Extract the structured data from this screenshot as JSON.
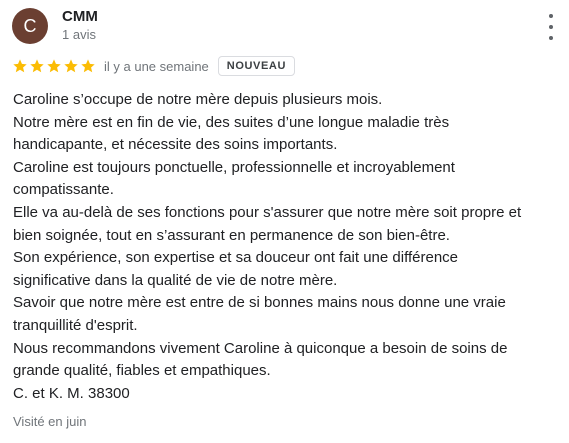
{
  "reviewer": {
    "initial": "C",
    "name": "CMM",
    "review_count": "1 avis",
    "avatar_color": "#6b3f31"
  },
  "rating": {
    "stars": 5,
    "max_stars": 5,
    "star_color": "#fbbc04",
    "time_ago": "il y a une semaine",
    "badge": "NOUVEAU"
  },
  "review": {
    "lines": [
      "Caroline s’occupe de notre mère depuis plusieurs mois.",
      "Notre mère est en fin de vie, des suites d’une longue maladie très",
      "handicapante, et nécessite des soins importants.",
      "Caroline est toujours ponctuelle, professionnelle et incroyablement",
      "compatissante.",
      "Elle va au-delà de ses fonctions pour s'assurer que notre mère soit propre et",
      "bien soignée, tout en s’assurant en permanence de son bien-être.",
      "Son expérience, son expertise et sa douceur ont fait une différence",
      "significative dans la qualité de vie de notre mère.",
      "Savoir que notre mère est entre de si bonnes mains nous donne une vraie",
      "tranquillité d'esprit.",
      "Nous recommandons vivement Caroline à quiconque a besoin de soins de",
      "grande qualité, fiables et empathiques.",
      "C. et K. M. 38300"
    ]
  },
  "visit": "Visité en juin"
}
